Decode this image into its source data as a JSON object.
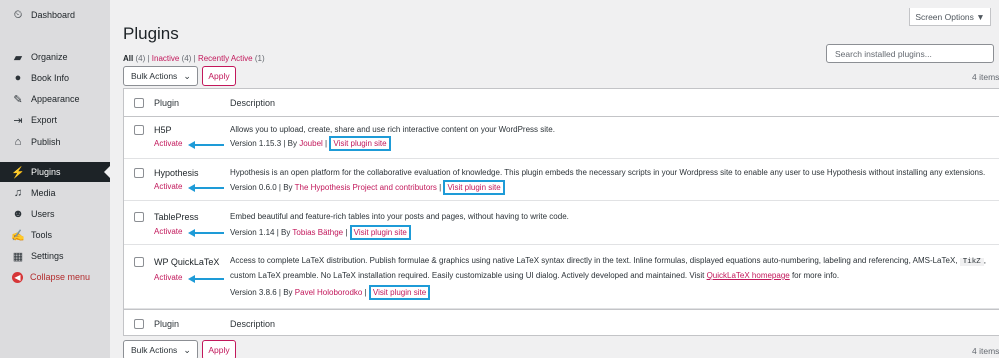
{
  "sidebar": {
    "items": [
      {
        "label": "Dashboard",
        "icon": "dashboard-icon",
        "glyph": "⏲"
      },
      {
        "label": "Organize",
        "icon": "book-icon",
        "glyph": "▰"
      },
      {
        "label": "Book Info",
        "icon": "info-icon",
        "glyph": "●"
      },
      {
        "label": "Appearance",
        "icon": "paintbrush-icon",
        "glyph": "✎"
      },
      {
        "label": "Export",
        "icon": "export-icon",
        "glyph": "⇥"
      },
      {
        "label": "Publish",
        "icon": "publish-icon",
        "glyph": "⌂"
      },
      {
        "label": "Plugins",
        "icon": "plugin-icon",
        "glyph": "⚡"
      },
      {
        "label": "Media",
        "icon": "media-icon",
        "glyph": "♫"
      },
      {
        "label": "Users",
        "icon": "users-icon",
        "glyph": "☻"
      },
      {
        "label": "Tools",
        "icon": "wrench-icon",
        "glyph": "✍"
      },
      {
        "label": "Settings",
        "icon": "settings-icon",
        "glyph": "▦"
      }
    ],
    "collapse_label": "Collapse menu"
  },
  "header": {
    "screen_options": "Screen Options ▼",
    "title": "Plugins",
    "filter_all": "All",
    "filter_all_count": "(4)",
    "filter_sep": "|",
    "filter_inactive": "Inactive",
    "filter_inactive_count": "(4)",
    "filter_recent": "Recently Active",
    "filter_recent_count": "(1)",
    "search_placeholder": "Search installed plugins..."
  },
  "toolbar": {
    "bulk_label": "Bulk Actions",
    "apply_label": "Apply",
    "items_count": "4 items"
  },
  "table": {
    "col_plugin": "Plugin",
    "col_description": "Description",
    "plugins": [
      {
        "name": "H5P",
        "action": "Activate",
        "description": "Allows you to upload, create, share and use rich interactive content on your WordPress site.",
        "version": "Version 1.15.3 | By ",
        "author": "Joubel",
        "sep": " | ",
        "visit": "Visit plugin site"
      },
      {
        "name": "Hypothesis",
        "action": "Activate",
        "description": "Hypothesis is an open platform for the collaborative evaluation of knowledge. This plugin embeds the necessary scripts in your Wordpress site to enable any user to use Hypothesis without installing any extensions.",
        "version": "Version 0.6.0 | By ",
        "author": "The Hypothesis Project and contributors",
        "sep": " | ",
        "visit": "Visit plugin site"
      },
      {
        "name": "TablePress",
        "action": "Activate",
        "description": "Embed beautiful and feature-rich tables into your posts and pages, without having to write code.",
        "version": "Version 1.14 | By ",
        "author": "Tobias Bäthge",
        "sep": " | ",
        "visit": "Visit plugin site"
      },
      {
        "name": "WP QuickLaTeX",
        "action": "Activate",
        "description_1": "Access to complete LaTeX distribution. Publish formulae & graphics using native LaTeX syntax directly in the text. Inline formulas, displayed equations auto-numbering, labeling and referencing, AMS-LaTeX,",
        "code_1": "TikZ",
        "description_1b": ",",
        "description_2": "custom LaTeX preamble. No LaTeX installation required. Easily customizable using UI dialog. Actively developed and maintained. Visit ",
        "homepage_link": "QuickLaTeX homepage",
        "description_2b": " for more info.",
        "version": "Version 3.8.6 | By ",
        "author": "Pavel Holoborodko",
        "sep": " | ",
        "visit": "Visit plugin site"
      }
    ]
  },
  "colors": {
    "link": "#c2185b",
    "highlight_box": "#1e9bd7",
    "arrow": "#1e9bd7",
    "sidebar_active": "#1d2327"
  }
}
